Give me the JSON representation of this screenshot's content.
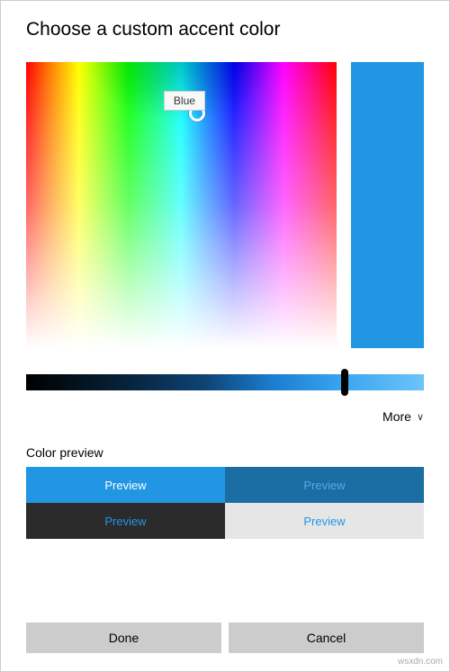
{
  "title": "Choose a custom accent color",
  "tooltip": "Blue",
  "selected_color": "#2196e3",
  "more_label": "More",
  "preview": {
    "heading": "Color preview",
    "cells": [
      "Preview",
      "Preview",
      "Preview",
      "Preview"
    ]
  },
  "buttons": {
    "done": "Done",
    "cancel": "Cancel"
  },
  "watermark": "wsxdn.com"
}
